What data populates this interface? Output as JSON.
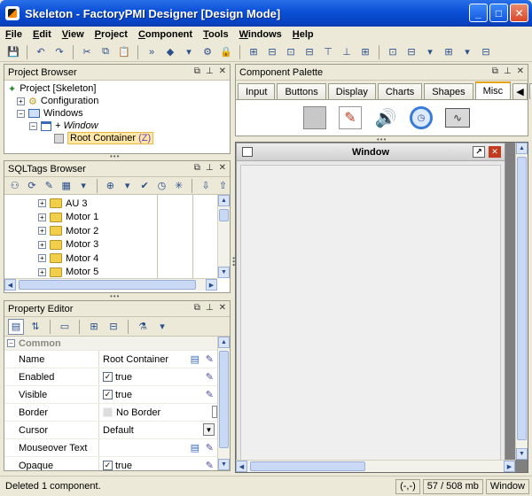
{
  "window": {
    "title": "Skeleton - FactoryPMI Designer [Design Mode]"
  },
  "menu": [
    {
      "label": "File",
      "u": "F",
      "rest": "ile"
    },
    {
      "label": "Edit",
      "u": "E",
      "rest": "dit"
    },
    {
      "label": "View",
      "u": "V",
      "rest": "iew"
    },
    {
      "label": "Project",
      "u": "P",
      "rest": "roject"
    },
    {
      "label": "Component",
      "u": "C",
      "rest": "omponent"
    },
    {
      "label": "Tools",
      "u": "T",
      "rest": "ools"
    },
    {
      "label": "Windows",
      "u": "W",
      "rest": "indows"
    },
    {
      "label": "Help",
      "u": "H",
      "rest": "elp"
    }
  ],
  "project_browser": {
    "title": "Project Browser",
    "items": [
      "Project [Skeleton]",
      "Configuration",
      "Windows",
      "+ Window",
      "Root Container",
      "(Z)"
    ]
  },
  "sqltags": {
    "title": "SQLTags Browser",
    "items": [
      "AU 3",
      "Motor 1",
      "Motor 2",
      "Motor 3",
      "Motor 4",
      "Motor 5"
    ]
  },
  "property_editor": {
    "title": "Property Editor",
    "section": "Common",
    "rows": [
      {
        "name": "Name",
        "value": "Root Container"
      },
      {
        "name": "Enabled",
        "value": "true"
      },
      {
        "name": "Visible",
        "value": "true"
      },
      {
        "name": "Border",
        "value": "No Border"
      },
      {
        "name": "Cursor",
        "value": "Default"
      },
      {
        "name": "Mouseover Text",
        "value": ""
      },
      {
        "name": "Opaque",
        "value": "true"
      }
    ]
  },
  "palette": {
    "title": "Component Palette",
    "tabs": [
      "Input",
      "Buttons",
      "Display",
      "Charts",
      "Shapes",
      "Misc"
    ],
    "active_tab": "Misc"
  },
  "canvas": {
    "window_title": "Window"
  },
  "status": {
    "message": "Deleted 1 component.",
    "coords": "(-,-)",
    "memory": "57 / 508 mb",
    "mode": "Window"
  }
}
